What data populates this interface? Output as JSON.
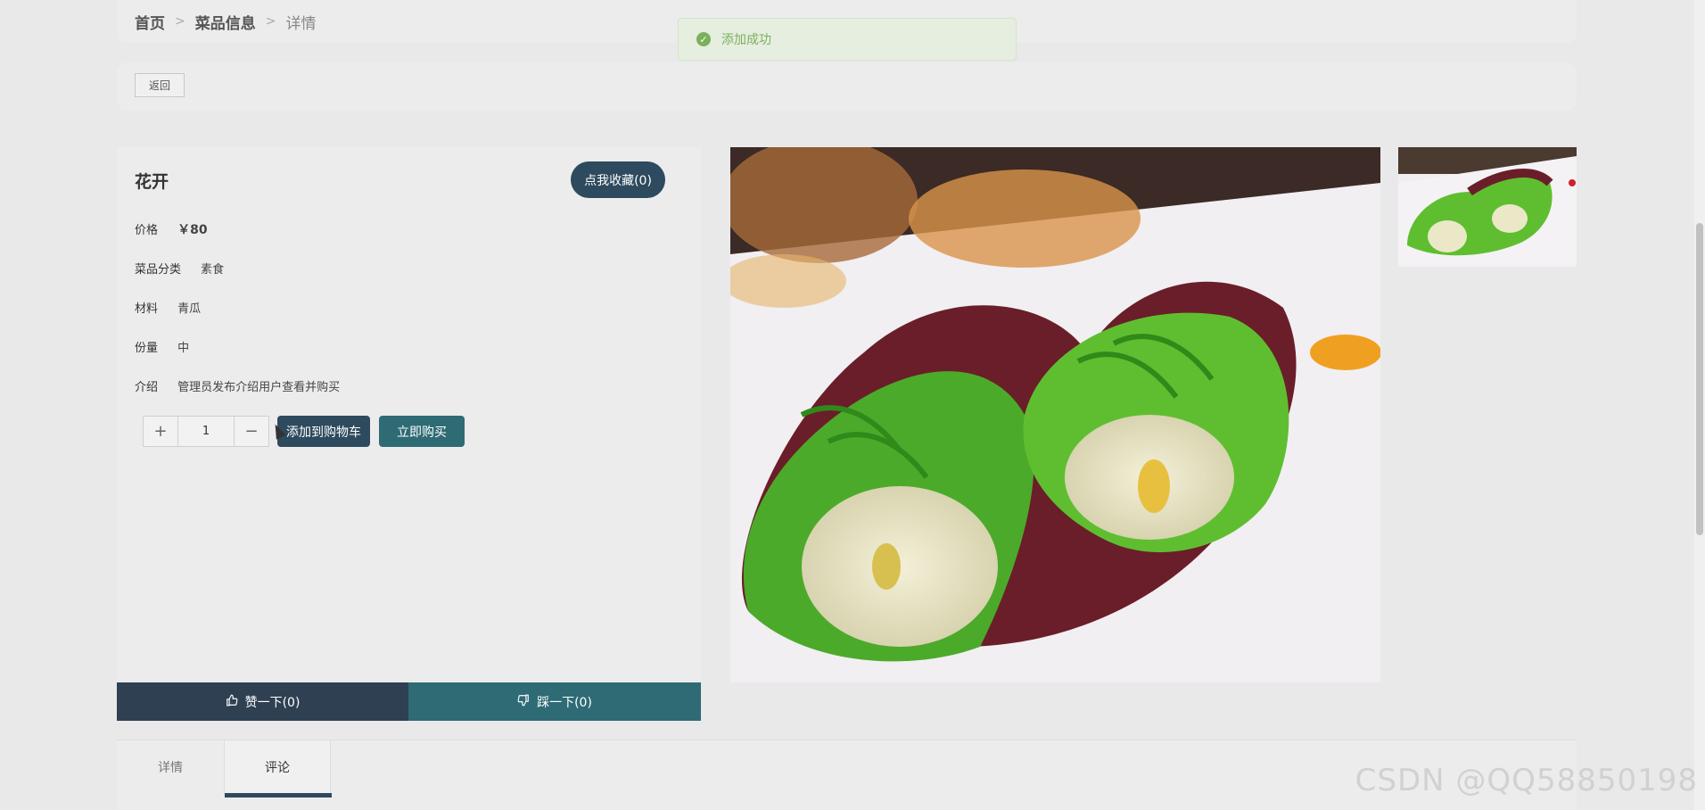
{
  "breadcrumb": {
    "home": "首页",
    "category": "菜品信息",
    "current": "详情",
    "separator": ">"
  },
  "back_button": "返回",
  "toast": {
    "message": "添加成功",
    "icon": "check-circle-icon",
    "color": "#7bb05c"
  },
  "product": {
    "name": "花开",
    "favorite_label": "点我收藏(0)",
    "attributes": [
      {
        "label": "价格",
        "value": "￥80"
      },
      {
        "label": "菜品分类",
        "value": "素食"
      },
      {
        "label": "材料",
        "value": "青瓜"
      },
      {
        "label": "份量",
        "value": "中"
      },
      {
        "label": "介绍",
        "value": "管理员发布介绍用户查看并购买"
      }
    ],
    "quantity": "1",
    "plus": "+",
    "minus": "−",
    "add_to_cart": "添加到购物车",
    "buy_now": "立即购买"
  },
  "votes": {
    "like_label": "赞一下(0)",
    "dislike_label": "踩一下(0)",
    "like_icon": "thumbs-up-icon",
    "dislike_icon": "thumbs-down-icon"
  },
  "tabs": [
    {
      "label": "详情",
      "active": false
    },
    {
      "label": "评论",
      "active": true
    }
  ],
  "watermark": "CSDN @QQ58850198",
  "colors": {
    "primary": "#2e4a5e",
    "secondary": "#2e6b74",
    "background": "#e9e9e9"
  }
}
